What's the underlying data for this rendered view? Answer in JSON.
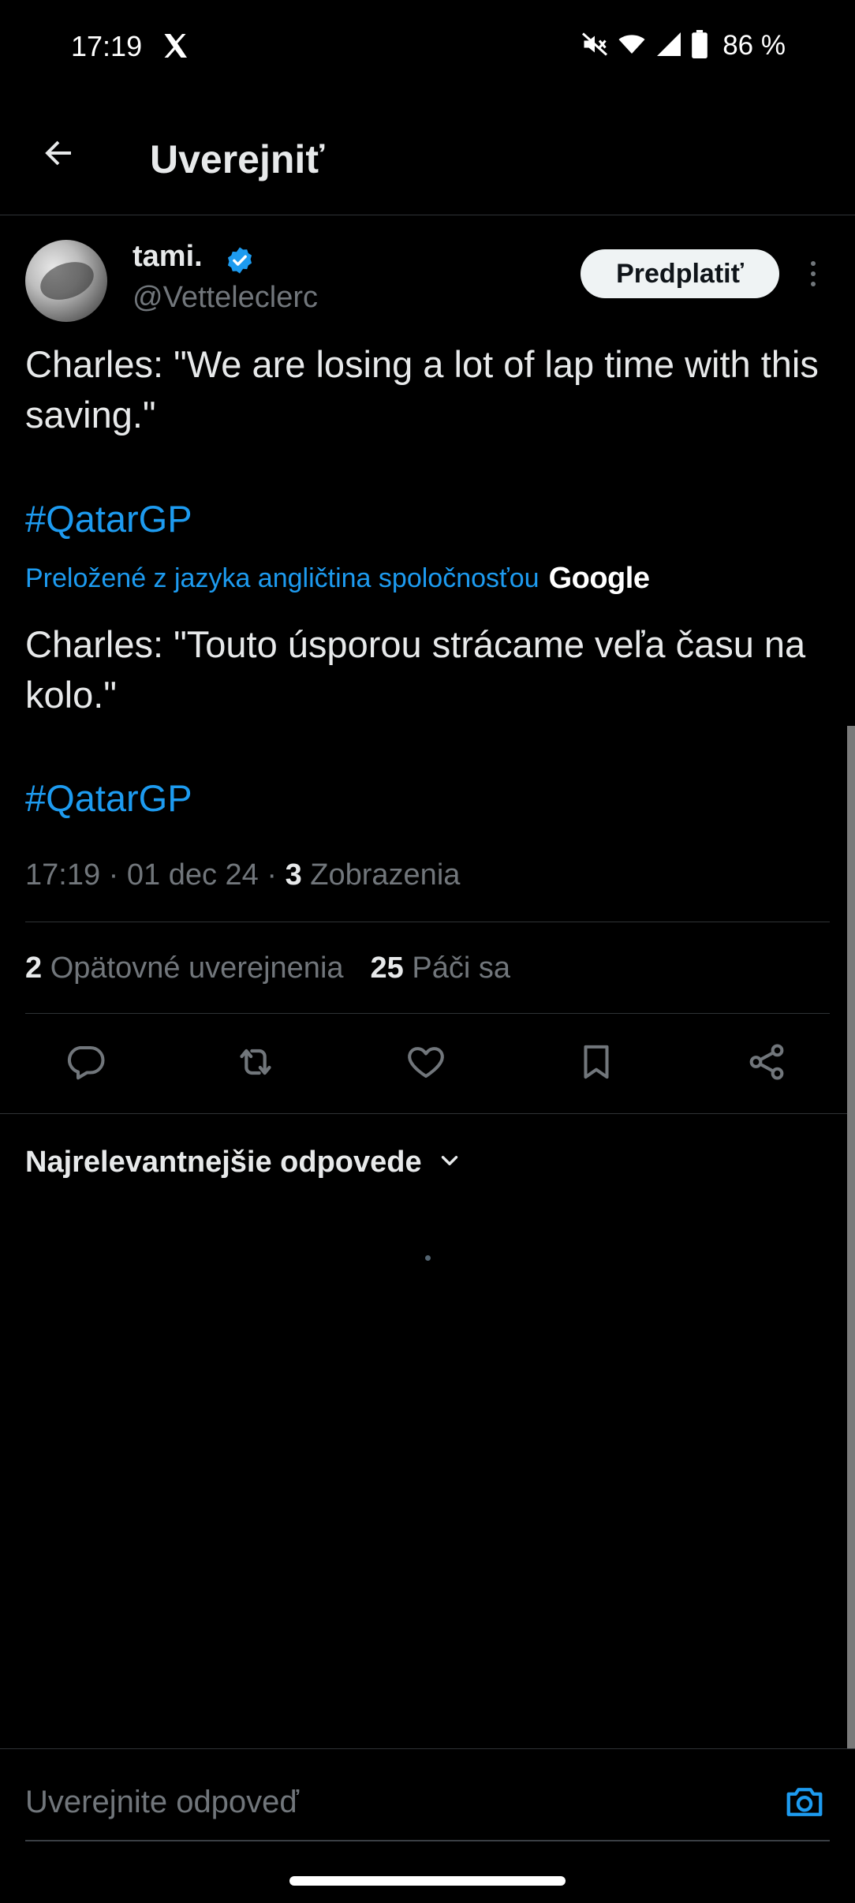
{
  "status_bar": {
    "time": "17:19",
    "battery": "86 %",
    "app_icon": "x-logo-icon"
  },
  "header": {
    "title": "Uverejniť",
    "back_icon": "back-arrow-icon"
  },
  "post": {
    "author": {
      "name": "tami.",
      "handle": "@Vetteleclerc",
      "verified": true
    },
    "subscribe_label": "Predplatiť",
    "original_text": "Charles: \"We are losing a lot of lap time with this saving.\"",
    "hashtag": "#QatarGP",
    "translation_label": "Preložené z jazyka angličtina spoločnosťou",
    "translation_provider": "Google",
    "translated_text": "Charles: \"Touto úsporou strácame veľa času na kolo.\"",
    "translated_hashtag": "#QatarGP",
    "meta": {
      "time": "17:19",
      "date": "01 dec 24",
      "views_count": "3",
      "views_label": "Zobrazenia",
      "separator": "·"
    },
    "stats": {
      "reposts_count": "2",
      "reposts_label": "Opätovné uverejnenia",
      "likes_count": "25",
      "likes_label": "Páči sa"
    }
  },
  "replies": {
    "sort_label": "Najrelevantnejšie odpovede"
  },
  "composer": {
    "placeholder": "Uverejnite odpoveď"
  },
  "colors": {
    "background": "#000000",
    "accent": "#1d9bf0",
    "text_primary": "#e7e9ea",
    "text_secondary": "#71767b",
    "divider": "#2f3336"
  }
}
